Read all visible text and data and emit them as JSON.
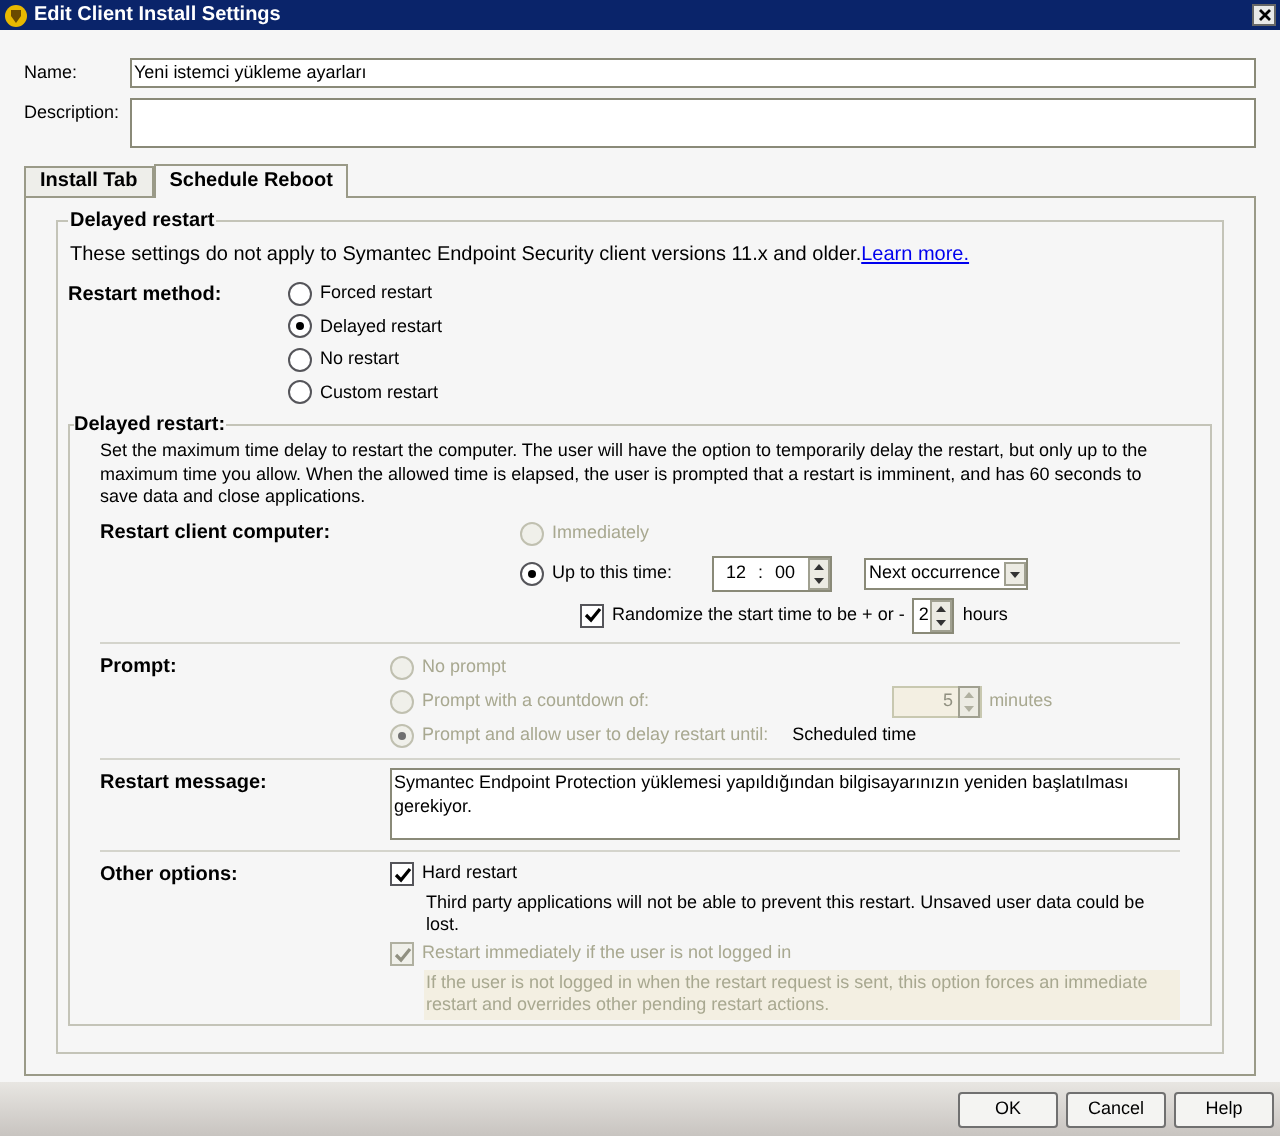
{
  "window": {
    "title": "Edit Client Install Settings"
  },
  "fields": [
    {
      "label": "Name:",
      "value": "Yeni istemci yükleme ayarları",
      "kind": "line"
    },
    {
      "label": "Description:",
      "kind": "area"
    }
  ],
  "tabs": [
    {
      "label": "Install Tab",
      "selected": false
    },
    {
      "label": "Schedule Reboot",
      "selected": true
    }
  ],
  "restart_group": {
    "title": "Delayed restart",
    "notice": "These settings do not apply to Symantec Endpoint Security client versions 11.x and older.",
    "link": "Learn more.",
    "method_label": "Restart method:",
    "methods": [
      {
        "label": "Forced restart",
        "selected": false
      },
      {
        "label": "Delayed restart",
        "selected": true
      },
      {
        "label": "No restart",
        "selected": false
      },
      {
        "label": "Custom restart",
        "selected": false
      }
    ]
  },
  "delayed_section": {
    "title": "Delayed restart:",
    "description": "Set the maximum time delay to restart the computer. The user will have the option to temporarily delay the restart, but only up to the maximum time you allow. When the allowed time is elapsed, the user is prompted that a restart is imminent, and has 60 seconds to save data and close applications.",
    "restart_client": {
      "label": "Restart client computer:",
      "options": [
        {
          "label": "Immediately",
          "selected": false,
          "disabled": true,
          "kind": "plain"
        },
        {
          "label": "Up to this time:",
          "selected": true,
          "disabled": false,
          "kind": "time"
        }
      ],
      "hour": "12",
      "separator": ":",
      "minute": "00",
      "occurrence": "Next occurrence",
      "randomize": {
        "label": "Randomize the start time to be + or -",
        "checked": true,
        "value": "2",
        "unit": "hours"
      }
    },
    "prompt": {
      "label": "Prompt:",
      "options": [
        {
          "label": "No prompt",
          "selected": false,
          "disabled": true,
          "kind": "plain"
        },
        {
          "label": "Prompt with a countdown of:",
          "selected": false,
          "disabled": true,
          "kind": "countdown"
        },
        {
          "label": "Prompt and allow user to delay restart until:",
          "selected": true,
          "disabled": true,
          "kind": "until"
        }
      ],
      "countdown": "5",
      "countdown_unit": "minutes",
      "until": "Scheduled time"
    },
    "restart_message": {
      "label": "Restart message:",
      "value": "Symantec Endpoint Protection yüklemesi yapıldığından bilgisayarınızın yeniden başlatılması gerekiyor."
    },
    "other_options": {
      "label": "Other options:",
      "items": [
        {
          "label": "Hard restart",
          "checked": true,
          "disabled": false,
          "note": "Third party applications will not be able to prevent this restart. Unsaved user data could be lost."
        },
        {
          "label": "Restart immediately if the user is not logged in",
          "checked": true,
          "disabled": true,
          "note": "If the user is not logged in when the restart request is sent, this option forces an immediate restart and overrides other pending restart actions."
        }
      ]
    }
  },
  "buttons": [
    "OK",
    "Cancel",
    "Help"
  ]
}
